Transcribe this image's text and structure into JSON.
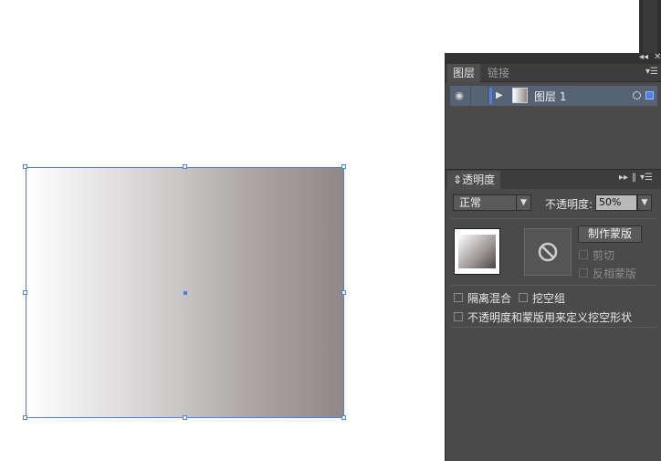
{
  "layers_panel": {
    "tabs": [
      {
        "label": "图层",
        "active": true
      },
      {
        "label": "链接",
        "active": false
      }
    ],
    "layers": [
      {
        "name": "图层 1",
        "visible": true,
        "color": "#4f7ee8",
        "selected": true
      }
    ]
  },
  "transparency_panel": {
    "title": "透明度",
    "blend_mode": "正常",
    "opacity_label": "不透明度:",
    "opacity_value": "50%",
    "make_mask_button": "制作蒙版",
    "clip_label": "剪切",
    "invert_mask_label": "反相蒙版",
    "isolate_blending_label": "隔离混合",
    "knockout_group_label": "挖空组",
    "opacity_mask_knockout_label": "不透明度和蒙版用来定义挖空形状"
  },
  "icons": {
    "collapse": "double-left-arrow-icon",
    "close": "close-icon",
    "menu": "panel-menu-icon",
    "eye": "eye-icon",
    "no_mask": "no-symbol-icon"
  },
  "colors": {
    "selection": "#4f7ee8",
    "panel_bg": "#4a4a4a",
    "layer_row_bg": "#566375"
  }
}
